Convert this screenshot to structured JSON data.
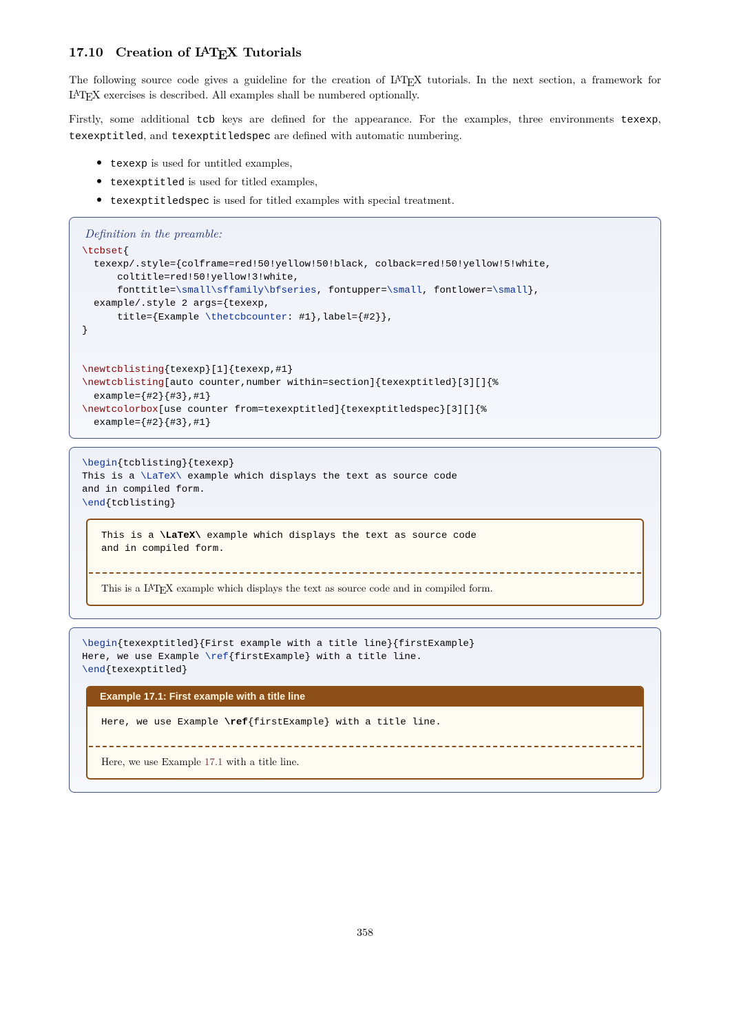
{
  "section": {
    "number": "17.10",
    "title_before": "Creation of ",
    "latex": "LaTeX",
    "title_after": " Tutorials"
  },
  "para1_a": "The following source code gives a guideline for the creation of ",
  "para1_b": " tutorials. In the next section, a framework for ",
  "para1_c": " exercises is described. All examples shall be numbered optionally.",
  "para2_a": "Firstly, some additional ",
  "para2_tcb": "tcb",
  "para2_b": " keys are defined for the appearance. For the examples, three environments ",
  "para2_env1": "texexp",
  "para2_c": ", ",
  "para2_env2": "texexptitled",
  "para2_d": ", and ",
  "para2_env3": "texexptitledspec",
  "para2_e": " are defined with automatic numbering.",
  "bullets": {
    "b1_a": "texexp",
    "b1_b": " is used for untitled examples,",
    "b2_a": "texexptitled",
    "b2_b": " is used for titled examples,",
    "b3_a": "texexptitledspec",
    "b3_b": " is used for titled examples with special treatment."
  },
  "box1": {
    "title": "Definition in the preamble:",
    "l01a": "\\tcbset",
    "l01b": "{",
    "l02": "  texexp/.style={colframe=red!50!yellow!50!black, colback=red!50!yellow!5!white,",
    "l03": "      coltitle=red!50!yellow!3!white,",
    "l04a": "      fonttitle=",
    "l04b": "\\small\\sffamily\\bfseries",
    "l04c": ", fontupper=",
    "l04d": "\\small",
    "l04e": ", fontlower=",
    "l04f": "\\small",
    "l04g": "},",
    "l05": "  example/.style 2 args={texexp,",
    "l06a": "      title={Example ",
    "l06b": "\\thetcbcounter",
    "l06c": ": #1},label={#2}},",
    "l07": "}",
    "l08": "",
    "l09": "",
    "l10a": "\\newtcblisting",
    "l10b": "{texexp}[1]{texexp,#1}",
    "l11a": "\\newtcblisting",
    "l11b": "[auto counter,number within=section]{texexptitled}[3][]{%",
    "l12": "  example={#2}{#3},#1}",
    "l13a": "\\newtcolorbox",
    "l13b": "[use counter from=texexptitled]{texexptitledspec}[3][]{%",
    "l14": "  example={#2}{#3},#1}"
  },
  "box2": {
    "l1a": "\\begin",
    "l1b": "{tcblisting}{texexp}",
    "l2a": "This is a ",
    "l2b": "\\LaTeX\\",
    "l2c": " example which displays the text as source code",
    "l3": "and in compiled form.",
    "l4a": "\\end",
    "l4b": "{tcblisting}",
    "inner_upper_l1a": "This is a ",
    "inner_upper_l1b": "\\LaTeX\\",
    "inner_upper_l1c": " example which displays the text as source code",
    "inner_upper_l2": "and in compiled form.",
    "inner_lower_a": "This is a ",
    "inner_lower_b": " example which displays the text as source code and in compiled form."
  },
  "box3": {
    "l1a": "\\begin",
    "l1b": "{texexptitled}{First example with a title line}{firstExample}",
    "l2a": "Here, we use Example ",
    "l2b": "\\ref",
    "l2c": "{firstExample} with a title line.",
    "l3a": "\\end",
    "l3b": "{texexptitled}",
    "title": "Example 17.1: First example with a title line",
    "inner_upper_l1a": "Here, we use Example ",
    "inner_upper_l1b": "\\ref",
    "inner_upper_l1c": "{firstExample} with a title line.",
    "inner_lower_a": "Here, we use Example ",
    "inner_lower_ref": "17.1",
    "inner_lower_b": " with a title line."
  },
  "page_number": "358"
}
